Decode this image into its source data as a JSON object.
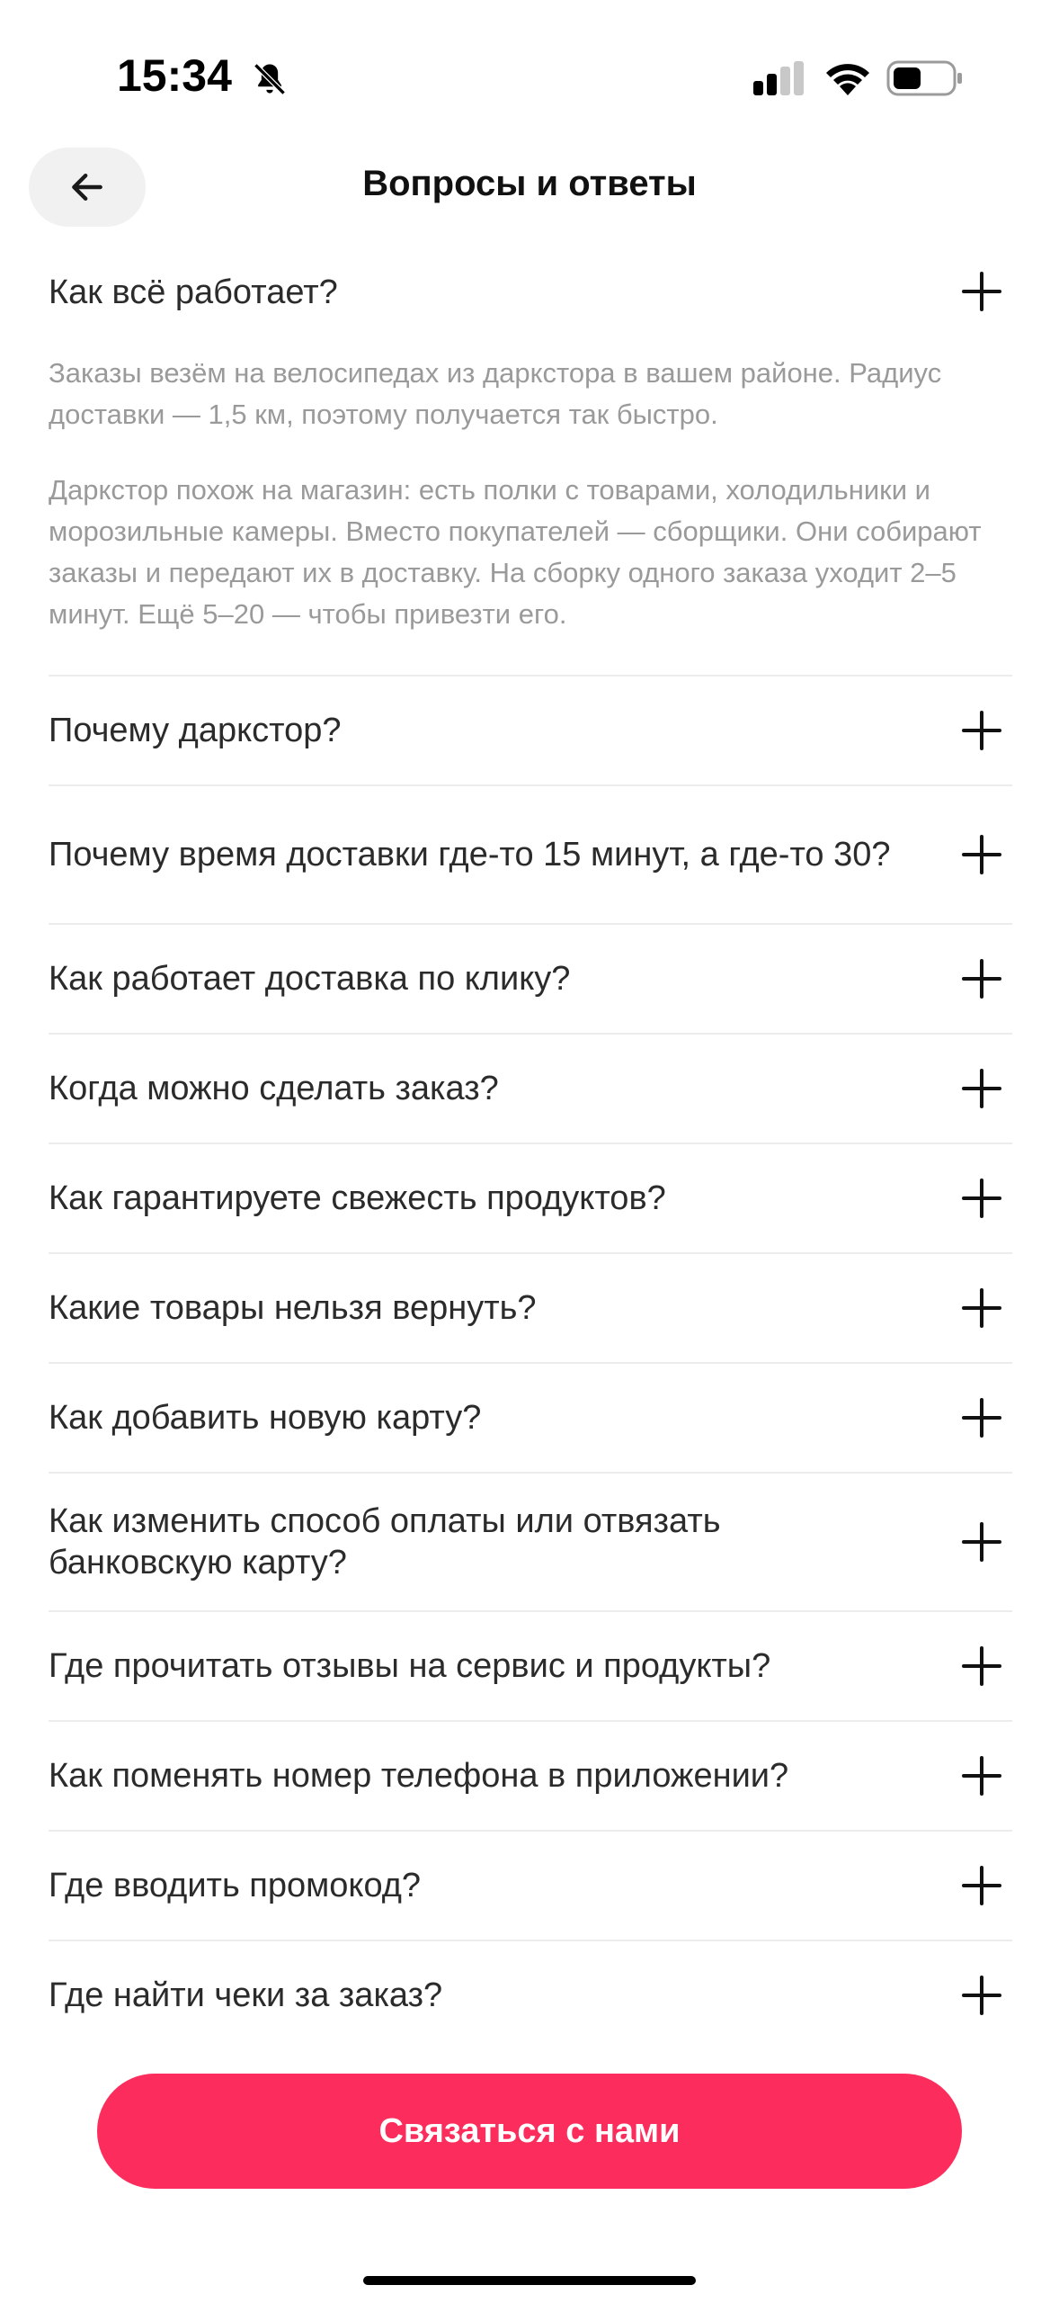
{
  "status_bar": {
    "time": "15:34",
    "icons": [
      "bell-muted-icon",
      "cellular-signal-icon",
      "wifi-icon",
      "battery-icon"
    ]
  },
  "header": {
    "back_icon": "arrow-left-icon",
    "title": "Вопросы и ответы"
  },
  "faq": {
    "expanded": {
      "question": "Как всё работает?",
      "answer": [
        "Заказы везём на велосипедах из даркстора в вашем районе. Радиус доставки — 1,5 км, поэтому получается так быстро.",
        "Даркстор похож на магазин: есть полки с товарами, холодильники и морозильные камеры. Вместо покупателей — сборщики. Они собирают заказы и передают их в доставку. На сборку одного заказа уходит 2–5 минут. Ещё 5–20 — чтобы привезти его."
      ]
    },
    "questions": [
      "Почему даркстор?",
      "Почему время доставки где-то 15 минут, а где-то 30?",
      "Как работает доставка по клику?",
      "Когда можно сделать заказ?",
      "Как гарантируете свежесть продуктов?",
      "Какие товары нельзя вернуть?",
      "Как добавить новую карту?",
      "Как изменить способ оплаты или отвязать банковскую карту?",
      "Где прочитать отзывы на сервис и продукты?",
      "Как поменять номер телефона в приложении?",
      "Где вводить промокод?",
      "Где найти чеки за заказ?"
    ],
    "toggle_icon": "plus-icon"
  },
  "contact": {
    "label": "Связаться с нами",
    "color": "#fc2d5c"
  }
}
